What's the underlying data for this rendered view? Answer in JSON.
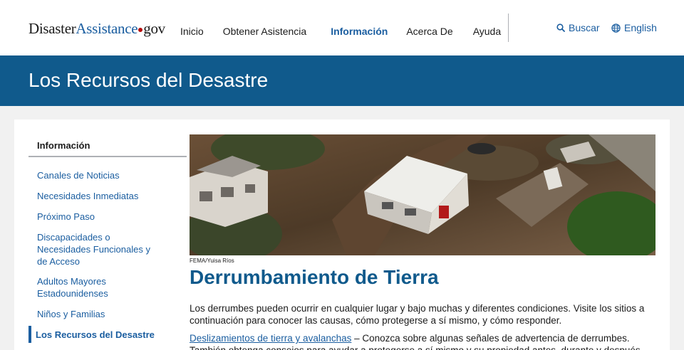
{
  "header": {
    "logo": {
      "part1": "Disaster",
      "part2": "Assistance",
      "part3": "gov"
    },
    "nav": [
      "Inicio",
      "Obtener Asistencia",
      "Información",
      "Acerca De",
      "Ayuda"
    ],
    "search_label": "Buscar",
    "language_label": "English"
  },
  "banner": {
    "title": "Los Recursos del Desastre"
  },
  "sidebar": {
    "heading": "Información",
    "items": [
      "Canales de Noticias",
      "Necesidades Inmediatas",
      "Próximo Paso",
      "Discapacidades o Necesidades Funcionales y de Acceso",
      "Adultos Mayores Estadounidenses",
      "Niños y Familias",
      "Los Recursos del Desastre"
    ]
  },
  "main": {
    "photo_caption": "FEMA/Yuisa Ríos",
    "title": "Derrumbamiento de Tierra",
    "paragraph1": "Los derrumbes pueden ocurrir en cualquier lugar y bajo muchas y diferentes condiciones. Visite los sitios a continuación para conocer las causas, cómo protegerse a sí mismo, y cómo responder.",
    "link1": "Deslizamientos de tierra y avalanchas",
    "paragraph2": " – Conozca sobre algunas señales de advertencia de derrumbes. También obtenga consejos para ayudar a protegerse a sí mismo y su propiedad antes, durante y después."
  },
  "colors": {
    "brand_blue": "#105a8c",
    "link_blue": "#1b5ea0",
    "accent_red": "#b50909"
  }
}
